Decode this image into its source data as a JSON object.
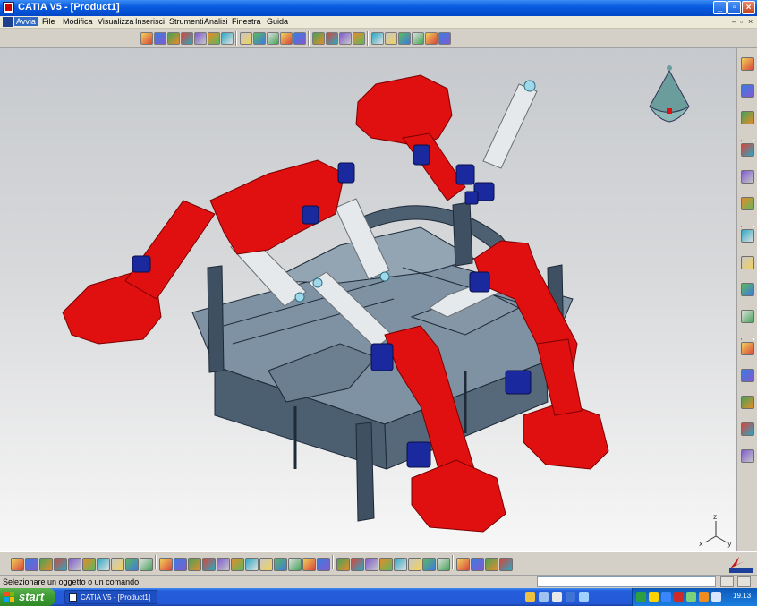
{
  "window": {
    "title": "CATIA V5 - [Product1]"
  },
  "menu": {
    "items": [
      "Avvia",
      "File",
      "Modifica",
      "Visualizza",
      "Inserisci",
      "Strumenti",
      "Analisi",
      "Finestra",
      "Guida"
    ]
  },
  "status": {
    "prompt": "Selezionare un oggetto o un comando"
  },
  "taskbar": {
    "start_label": "start",
    "task_label": "CATIA V5 - [Product1]",
    "clock": "19.13"
  },
  "colors": {
    "robot_red": "#e01010",
    "robot_blue": "#1a2a9e",
    "arm_white": "#e6e9ec",
    "frame_steel": "#5f7486",
    "compass_teal": "#6a9d9c"
  },
  "icons": {
    "top_toolbar": [
      "catalog-icon",
      "knowledge-icon",
      "tools-icon",
      "analysis-icon",
      "update-icon",
      "replace-icon",
      "generate-icon",
      "animation-icon",
      "assembly-constraint-icon",
      "fix-icon",
      "manipulate-icon",
      "snap-icon",
      "explode-icon",
      "clash-icon",
      "section-icon",
      "measure-icon",
      "fly-icon",
      "look-at-icon",
      "zoom-icon",
      "render-icon",
      "material-icon",
      "sketch-icon"
    ],
    "right_toolbar": [
      "compass-icon",
      "product-icon",
      "component-icon",
      "insert-icon",
      "select-icon",
      "manipulation-icon",
      "constraint-icon",
      "offset-icon",
      "angle-icon",
      "fix-together-icon",
      "reuse-pattern-icon",
      "explode-view-icon",
      "sectioning-icon",
      "space-analysis-icon",
      "scene-icon"
    ],
    "bottom_toolbar": [
      "new-icon",
      "open-icon",
      "save-icon",
      "print-icon",
      "cut-icon",
      "copy-icon",
      "paste-icon",
      "undo-icon",
      "redo-icon",
      "whats-this-icon",
      "fly-mode-icon",
      "fit-all-icon",
      "pan-icon",
      "rotate-icon",
      "zoom-in-icon",
      "zoom-out-icon",
      "normal-view-icon",
      "multi-view-icon",
      "iso-view-icon",
      "render-style-icon",
      "hide-show-icon",
      "swap-space-icon",
      "formula-icon",
      "comment-icon",
      "light-icon",
      "grid-icon",
      "tree-icon",
      "mass-icon",
      "scale-icon",
      "measure-between-icon",
      "measure-item-icon",
      "measure-inertia-icon",
      "check-icon",
      "macro-icon"
    ]
  }
}
